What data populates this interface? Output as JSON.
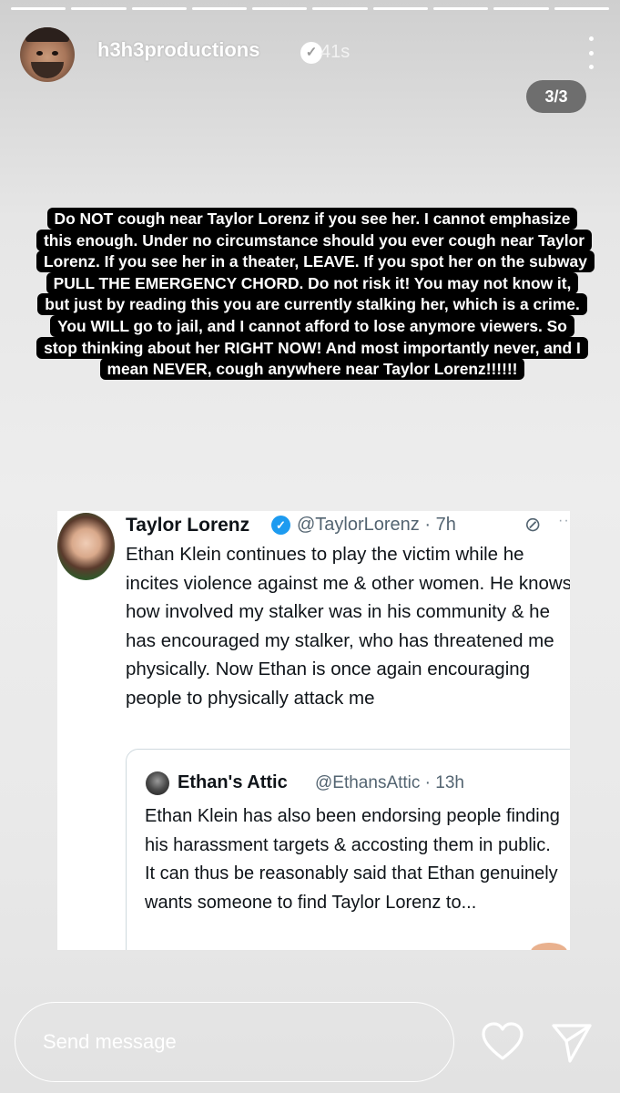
{
  "story": {
    "segments": 10,
    "username": "h3h3productions",
    "verified_glyph": "✓",
    "time": "41s",
    "counter": "3/3"
  },
  "caption": "Do NOT cough near Taylor Lorenz if you see her. I cannot emphasize this enough. Under no circumstance should you ever cough near Taylor Lorenz. If you see her in a theater, LEAVE. If you spot her on the subway PULL THE EMERGENCY CHORD. Do not risk it! You may not know it, but just by reading this you are currently stalking her, which is a crime. You WILL go to jail, and I cannot afford to lose anymore viewers.  So stop thinking about her RIGHT NOW! And most importantly never, and I mean NEVER, cough anywhere near Taylor Lorenz!!!!!!",
  "tweet": {
    "name": "Taylor Lorenz",
    "badge_glyph": "✓",
    "handle_time": "@TaylorLorenz · 7h",
    "icon_glyph": "⊘",
    "dots": "··",
    "body": "Ethan Klein continues to play the victim while he incites violence against me & other women. He knows how involved my stalker was in his community & he has encouraged my stalker, who has threatened me physically. Now Ethan is once again encouraging people to physically attack me",
    "quote": {
      "name": "Ethan's Attic",
      "handle_time": "@EthansAttic · 13h",
      "body": "Ethan Klein has also been endorsing people finding his harassment targets & accosting them in public. It can thus be reasonably said that Ethan genuinely wants someone to find Taylor Lorenz to..."
    }
  },
  "footer": {
    "send_placeholder": "Send message",
    "icons": [
      "heart-icon",
      "share-icon"
    ]
  },
  "colors": {
    "caption_bg": "#000000",
    "caption_text": "#ffffff",
    "verified_blue": "#1d9bf0",
    "counter_bg": "#6e6e6e"
  }
}
